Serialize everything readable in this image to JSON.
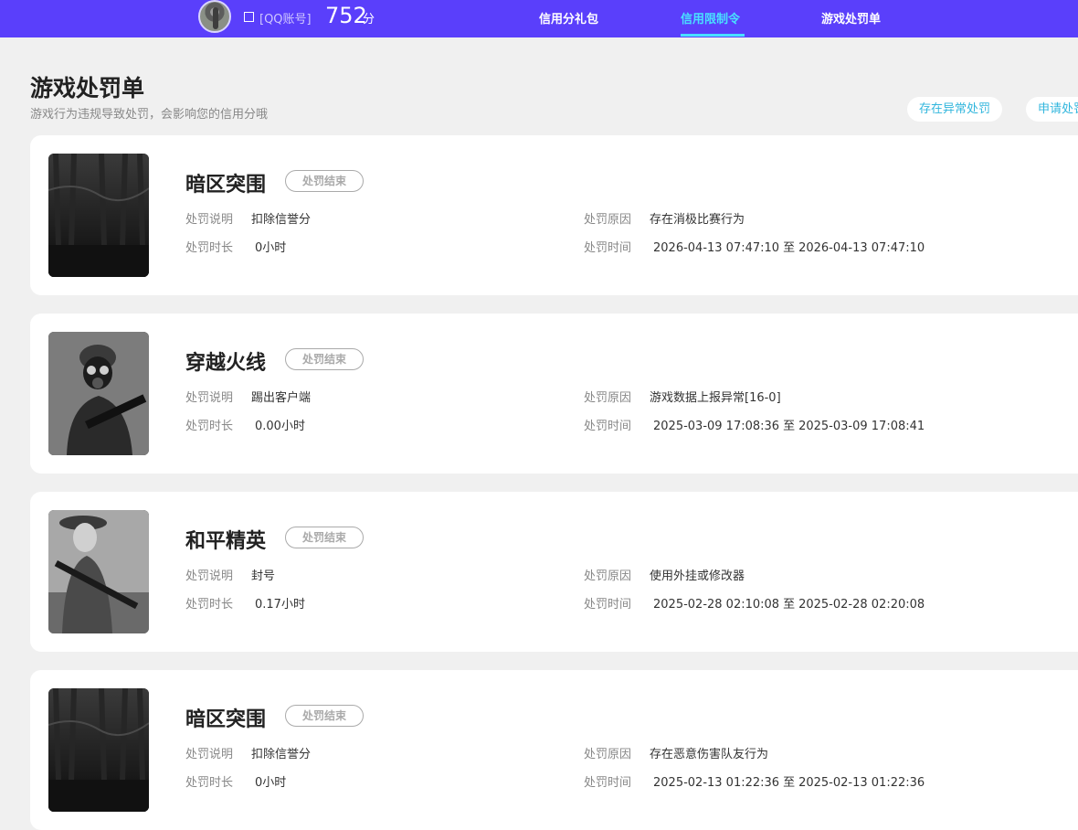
{
  "header": {
    "account_label": "[QQ账号]",
    "score": "752",
    "score_unit": "分",
    "nav": [
      {
        "label": "信用分礼包"
      },
      {
        "label": "信用限制令"
      },
      {
        "label": "游戏处罚单"
      }
    ],
    "active_nav": "信用限制令",
    "accent_color": "#49e0ff",
    "bar_color": "#5a3ffb"
  },
  "page": {
    "title": "游戏处罚单",
    "subtitle": "游戏行为违规导致处罚，会影响您的信用分哦",
    "buttons": [
      {
        "label": "存在异常处罚"
      },
      {
        "label": "申请处罚"
      }
    ]
  },
  "labels": {
    "desc": "处罚说明",
    "duration": "处罚时长",
    "reason": "处罚原因",
    "time": "处罚时间",
    "time_sep": "至"
  },
  "penalties": [
    {
      "game": "暗区突围",
      "status": "处罚结束",
      "desc": "扣除信誉分",
      "duration": "0小时",
      "reason": "存在消极比赛行为",
      "start": "2026-04-13 07:47:10",
      "end": "2026-04-13 07:47:10",
      "icon": "forest-game-icon"
    },
    {
      "game": "穿越火线",
      "status": "处罚结束",
      "desc": "踢出客户端",
      "duration": "0.00小时",
      "reason": "游戏数据上报异常[16-0]",
      "start": "2025-03-09 17:08:36",
      "end": "2025-03-09 17:08:41",
      "icon": "soldier-gasmask-icon"
    },
    {
      "game": "和平精英",
      "status": "处罚结束",
      "desc": "封号",
      "duration": "0.17小时",
      "reason": "使用外挂或修改器",
      "start": "2025-02-28 02:10:08",
      "end": "2025-02-28 02:20:08",
      "icon": "soldier-rifle-icon"
    },
    {
      "game": "暗区突围",
      "status": "处罚结束",
      "desc": "扣除信誉分",
      "duration": "0小时",
      "reason": "存在恶意伤害队友行为",
      "start": "2025-02-13 01:22:36",
      "end": "2025-02-13 01:22:36",
      "icon": "forest-game-icon"
    }
  ]
}
